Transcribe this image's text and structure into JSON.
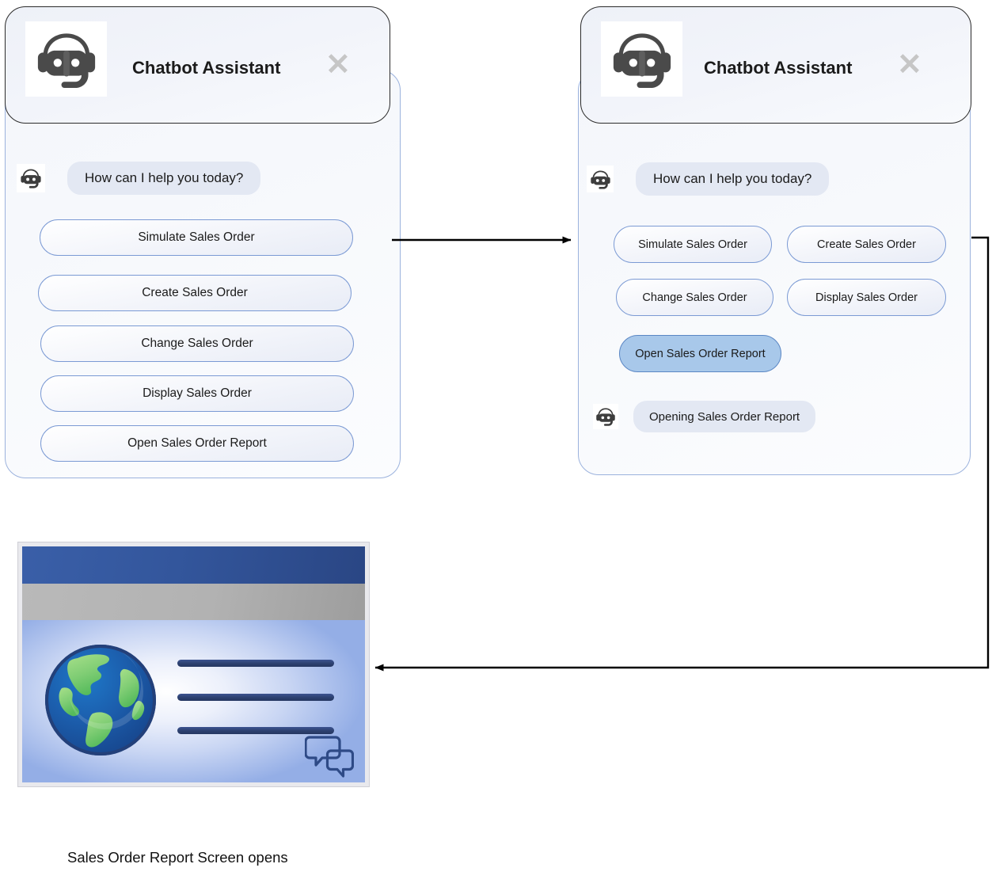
{
  "diagram": {
    "caption": "Sales Order Report Screen opens"
  },
  "panels": [
    {
      "id": "panel-initial",
      "header": {
        "title": "Chatbot Assistant",
        "logo_icon": "chatbot-robot-headset-icon",
        "close_icon": "close-icon",
        "close_glyph": "✕"
      },
      "messages": [
        {
          "avatar_icon": "chatbot-robot-headset-icon",
          "text": "How can I help you today?"
        }
      ],
      "options": [
        {
          "label": "Simulate Sales Order",
          "selected": false
        },
        {
          "label": "Create Sales Order",
          "selected": false
        },
        {
          "label": "Change Sales Order",
          "selected": false
        },
        {
          "label": "Display Sales Order",
          "selected": false
        },
        {
          "label": "Open Sales Order Report",
          "selected": false
        }
      ]
    },
    {
      "id": "panel-selected",
      "header": {
        "title": "Chatbot Assistant",
        "logo_icon": "chatbot-robot-headset-icon",
        "close_icon": "close-icon",
        "close_glyph": "✕"
      },
      "messages": [
        {
          "avatar_icon": "chatbot-robot-headset-icon",
          "text": "How can I help you today?"
        },
        {
          "avatar_icon": "chatbot-robot-headset-icon",
          "text": "Opening Sales Order Report"
        }
      ],
      "options": [
        {
          "label": "Simulate Sales Order",
          "selected": false
        },
        {
          "label": "Create Sales Order",
          "selected": false
        },
        {
          "label": "Change Sales Order",
          "selected": false
        },
        {
          "label": "Display Sales Order",
          "selected": false
        },
        {
          "label": "Open Sales Order Report",
          "selected": true
        }
      ]
    }
  ],
  "browser_window": {
    "name": "sales-order-report-screen",
    "globe_icon": "globe-icon",
    "chat_bubbles_icon": "chat-bubbles-icon",
    "content_lines": 3
  },
  "colors": {
    "chip_border": "#7b9ad4",
    "chip_selected_fill": "#a8c8ea",
    "bubble_fill": "#e3e8f3",
    "panel_border": "#9bb2dd",
    "header_border": "#2b2b2b",
    "arrow": "#000000",
    "browser_titlebar": "#33569c",
    "browser_toolbar": "#b2b2b2",
    "browser_progress": "#1e9b45",
    "report_line": "#2c406f"
  }
}
